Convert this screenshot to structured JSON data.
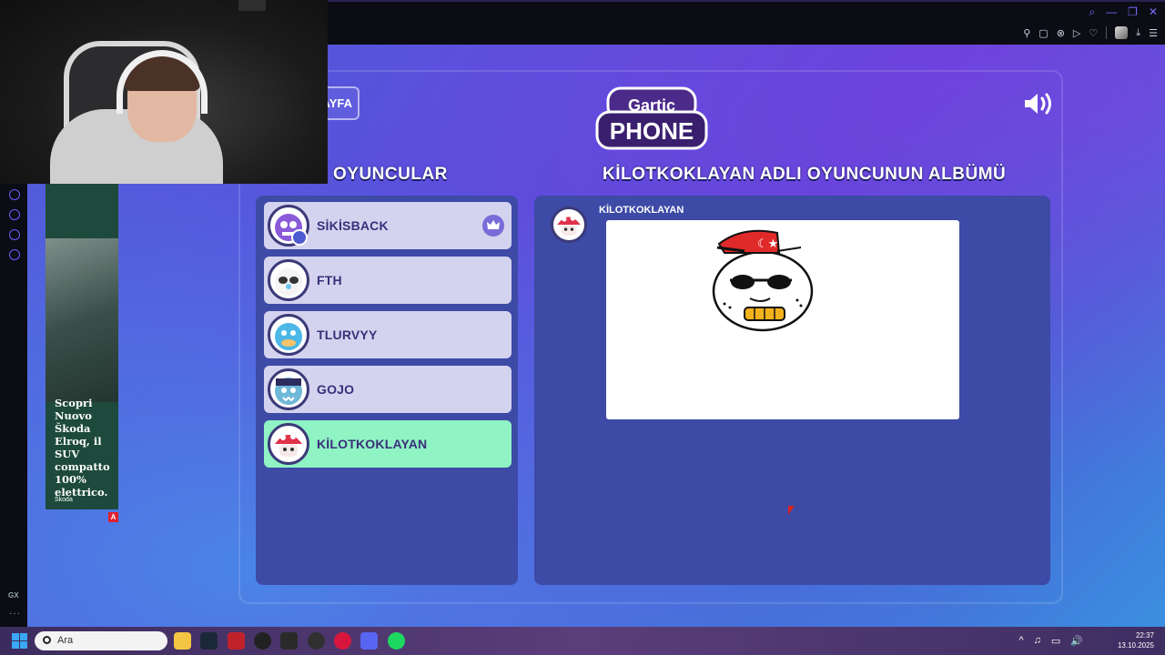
{
  "window": {
    "controls": [
      "search",
      "minimize",
      "restore",
      "close"
    ]
  },
  "game": {
    "back_label": "AYFA",
    "logo_top": "Gartic",
    "logo_bottom": "PHONE",
    "players_heading": "OYUNCULAR",
    "album_heading": "KİLOTKOKLAYAN ADLI OYUNCUNUN ALBÜMÜ",
    "players": [
      {
        "name": "SİKİSBACK",
        "icon": "purple-monster-avatar",
        "host": true,
        "active": false
      },
      {
        "name": "FTH",
        "icon": "panda-avatar",
        "host": false,
        "active": false
      },
      {
        "name": "TLURVYY",
        "icon": "blue-creature-avatar",
        "host": false,
        "active": false
      },
      {
        "name": "GOJO",
        "icon": "vampire-avatar",
        "host": false,
        "active": false
      },
      {
        "name": "KİLOTKOKLAYAN",
        "icon": "mushroom-avatar",
        "host": false,
        "active": true
      }
    ],
    "album": {
      "author": "KİLOTKOKLAYAN",
      "drawing": "face-with-turkish-flag-cap-and-sunglasses"
    }
  },
  "ad": {
    "text": "Scopri Nuovo Škoda Elroq, il SUV compatto 100% elettrico.",
    "brand": "Škoda",
    "tag": "A"
  },
  "taskbar": {
    "search_placeholder": "Ara",
    "apps": [
      "file-explorer",
      "steam",
      "red-app",
      "settings-wheel",
      "epic-games",
      "obs",
      "opera-gx",
      "discord",
      "spotify"
    ],
    "time": "22:37",
    "date": "13.10.2025"
  },
  "colors": {
    "accent": "#7e6bff",
    "panel": "#3d4aa6",
    "player_bg": "#d4d3ef",
    "player_active": "#8ff3c4"
  }
}
